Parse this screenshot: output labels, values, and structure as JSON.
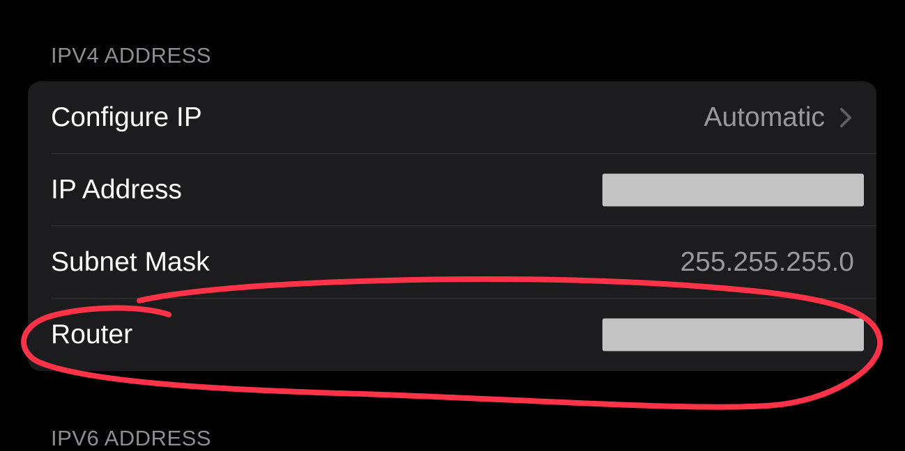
{
  "colors": {
    "background": "#000000",
    "group_background": "#1c1c1e",
    "label_text": "#ffffff",
    "secondary_text": "#98989f",
    "redaction": "#c3c3c3",
    "annotation": "#ff3347"
  },
  "sections": {
    "ipv4_header": "IPV4 ADDRESS",
    "ipv6_header": "IPV6 ADDRESS"
  },
  "rows": {
    "configure_ip": {
      "label": "Configure IP",
      "value": "Automatic",
      "icon": "chevron-right-icon"
    },
    "ip_address": {
      "label": "IP Address",
      "redacted": true
    },
    "subnet_mask": {
      "label": "Subnet Mask",
      "value": "255.255.255.0"
    },
    "router": {
      "label": "Router",
      "redacted": true
    }
  },
  "annotation": {
    "type": "hand-drawn-circle",
    "target": "Router"
  }
}
